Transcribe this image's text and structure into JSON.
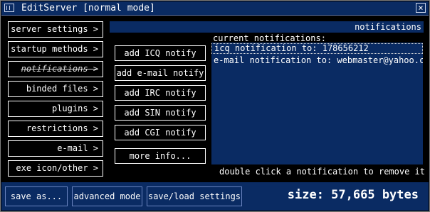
{
  "window": {
    "title": "EditServer [normal mode]",
    "close_glyph": "×"
  },
  "sidebar": {
    "items": [
      {
        "label": "server settings >"
      },
      {
        "label": "startup methods >"
      },
      {
        "label": "notifications >"
      },
      {
        "label": "binded files >"
      },
      {
        "label": "plugins >"
      },
      {
        "label": "restrictions >"
      },
      {
        "label": "e-mail >"
      },
      {
        "label": "exe icon/other >"
      }
    ],
    "active_index": 2
  },
  "panel": {
    "header": "notifications",
    "actions": [
      {
        "label": "add ICQ notify"
      },
      {
        "label": "add e-mail notify"
      },
      {
        "label": "add IRC notify"
      },
      {
        "label": "add SIN notify"
      },
      {
        "label": "add CGI notify"
      },
      {
        "label": "more info..."
      }
    ],
    "list_label": "current notifications:",
    "notifications": [
      {
        "text": "icq notification to: 178656212",
        "selected": true
      },
      {
        "text": "e-mail notification to: webmaster@yahoo.com",
        "selected": false
      }
    ],
    "hint": "double click a notification to remove it"
  },
  "bottom": {
    "save_as": "save as...",
    "advanced_mode": "advanced mode",
    "save_load": "save/load settings",
    "size": "size: 57,665 bytes"
  },
  "colors": {
    "panel_blue": "#0a2b63",
    "background": "#000000",
    "text": "#ffffff"
  }
}
